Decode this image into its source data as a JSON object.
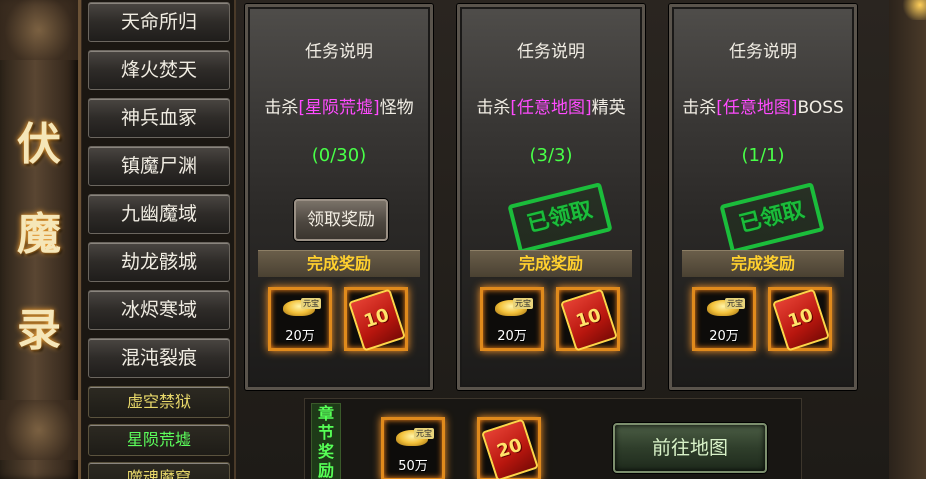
{
  "banner": {
    "chars": [
      "伏",
      "魔",
      "录"
    ]
  },
  "map_list": {
    "items": [
      "天命所归",
      "烽火焚天",
      "神兵血冢",
      "镇魔尸渊",
      "九幽魔域",
      "劫龙骸城",
      "冰烬寒域",
      "混沌裂痕"
    ],
    "sub_items": [
      "虚空禁狱",
      "星陨荒墟",
      "噬魂魔窟"
    ]
  },
  "cards": [
    {
      "header": "任务说明",
      "desc_prefix": "击杀",
      "desc_highlight": "[星陨荒墟]",
      "desc_suffix": "怪物",
      "progress": "(0/30)",
      "claim_label": "领取奖励",
      "claimed": false,
      "reward_label": "完成奖励",
      "gold": "20万",
      "ingot_tag": "元宝",
      "redpack": "10"
    },
    {
      "header": "任务说明",
      "desc_prefix": "击杀",
      "desc_highlight": "[任意地图]",
      "desc_suffix": "精英",
      "progress": "(3/3)",
      "stamp": "已领取",
      "claimed": true,
      "reward_label": "完成奖励",
      "gold": "20万",
      "ingot_tag": "元宝",
      "redpack": "10"
    },
    {
      "header": "任务说明",
      "desc_prefix": "击杀",
      "desc_highlight": "[任意地图]",
      "desc_suffix": "BOSS",
      "progress": "(1/1)",
      "stamp": "已领取",
      "claimed": true,
      "reward_label": "完成奖励",
      "gold": "20万",
      "ingot_tag": "元宝",
      "redpack": "10"
    }
  ],
  "chapter": {
    "label": "章节奖励",
    "gold": "50万",
    "ingot_tag": "元宝",
    "redpack": "20",
    "go_label": "前往地图"
  },
  "colors": {
    "highlight": "#ff4bff",
    "progress": "#48ff48",
    "reward": "#ffd02e",
    "stamp": "#1bbd3b"
  }
}
